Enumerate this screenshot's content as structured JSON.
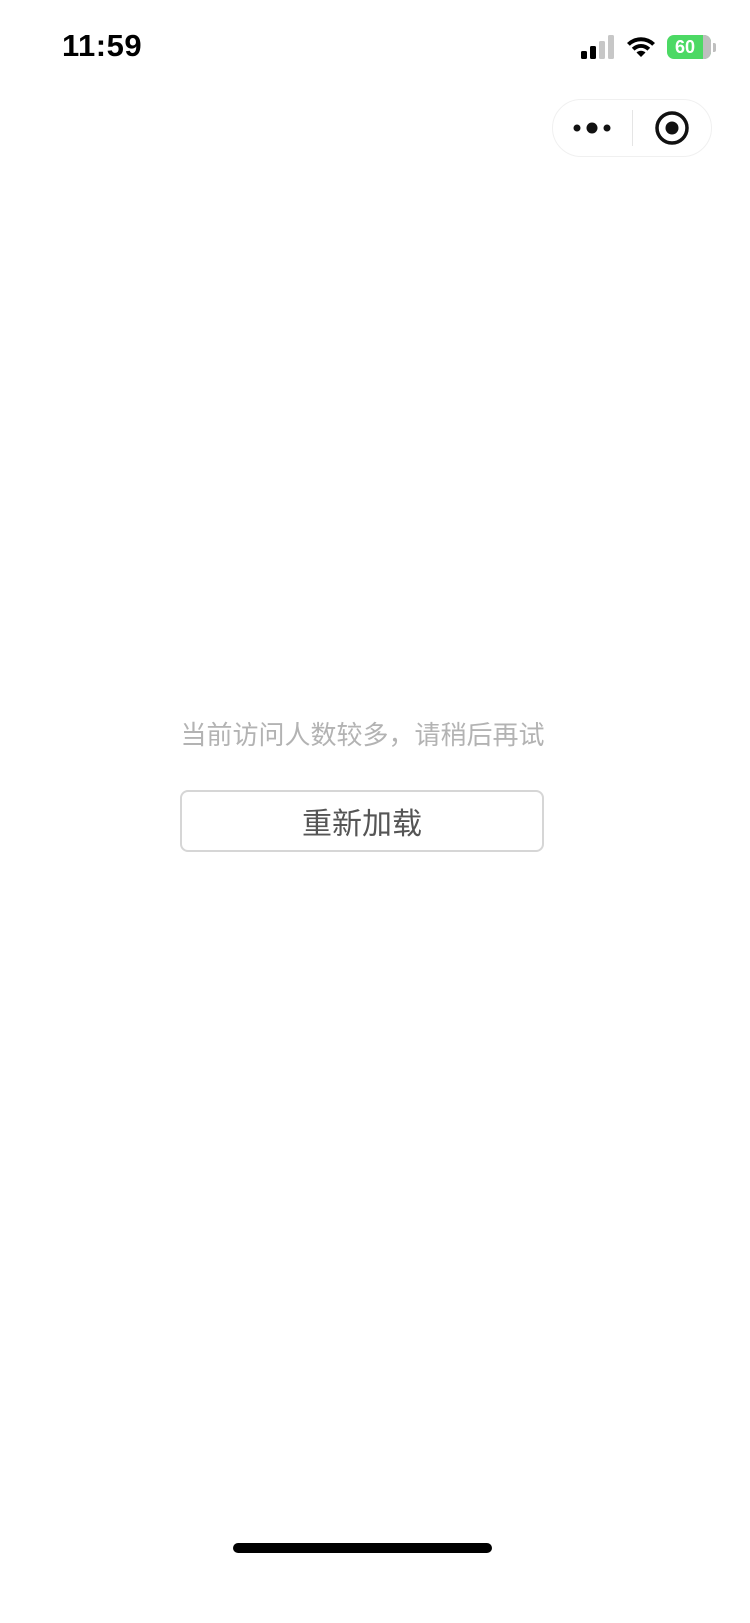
{
  "status_bar": {
    "time": "11:59",
    "battery_level": "60",
    "battery_charging": true,
    "signal_icon": "cellular-signal-icon",
    "wifi_icon": "wifi-icon",
    "battery_color": "#4cd964"
  },
  "capsule": {
    "more_icon": "more-dots-icon",
    "close_icon": "target-close-icon"
  },
  "main": {
    "message": "当前访问人数较多，请稍后再试",
    "reload_label": "重新加载"
  }
}
